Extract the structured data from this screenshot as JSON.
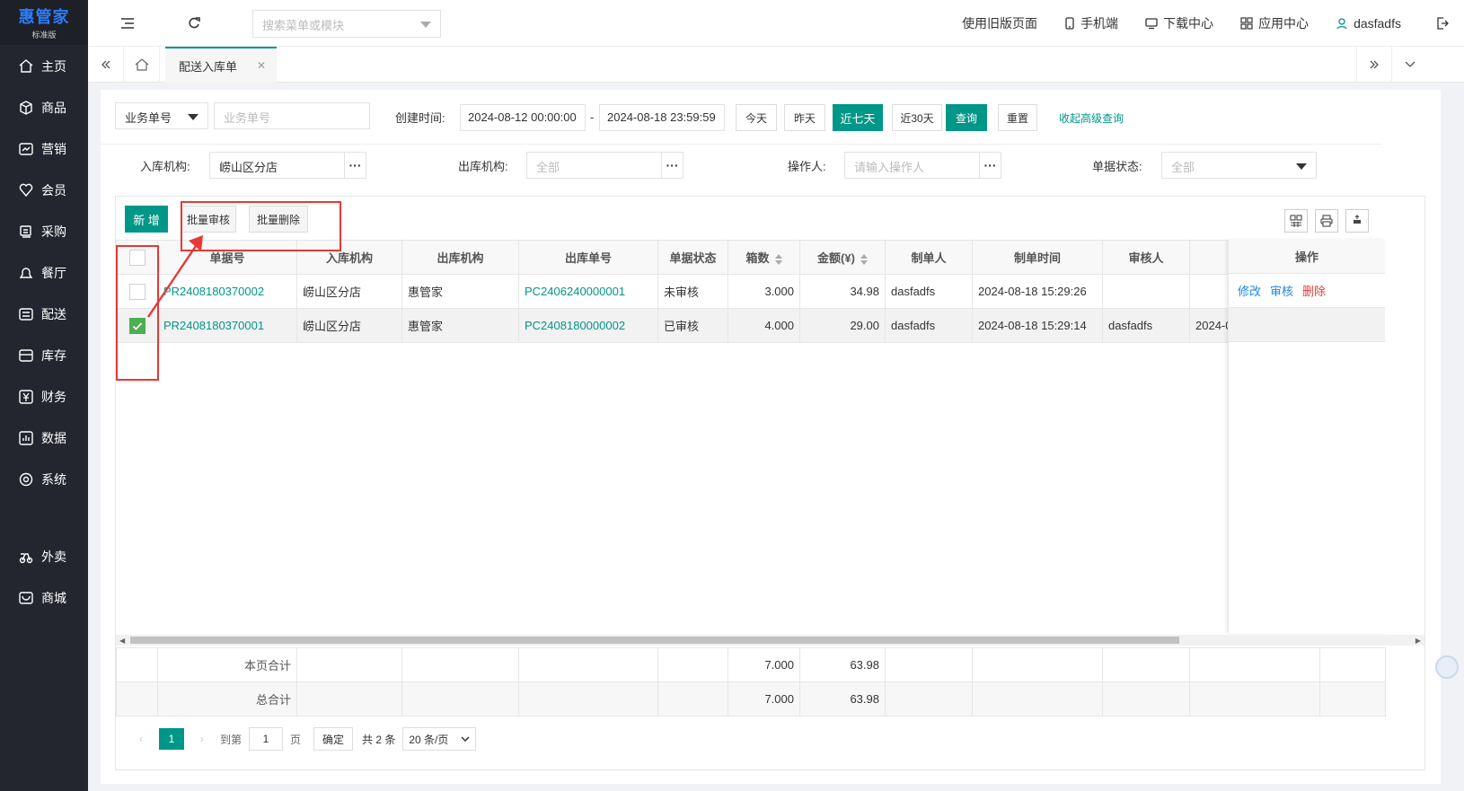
{
  "brand": {
    "name": "惠管家",
    "edition": "标准版"
  },
  "sidebar": {
    "items": [
      {
        "label": "主页",
        "icon": "home-icon"
      },
      {
        "label": "商品",
        "icon": "box-icon"
      },
      {
        "label": "营销",
        "icon": "chart-icon"
      },
      {
        "label": "会员",
        "icon": "heart-icon"
      },
      {
        "label": "采购",
        "icon": "cart-icon"
      },
      {
        "label": "餐厅",
        "icon": "bell-icon"
      },
      {
        "label": "配送",
        "icon": "truck-icon"
      },
      {
        "label": "库存",
        "icon": "storage-icon"
      },
      {
        "label": "财务",
        "icon": "yen-icon"
      },
      {
        "label": "数据",
        "icon": "bar-chart-icon"
      },
      {
        "label": "系统",
        "icon": "settings-icon"
      },
      {
        "label": "外卖",
        "icon": "delivery-icon"
      },
      {
        "label": "商城",
        "icon": "shop-icon"
      }
    ]
  },
  "topbar": {
    "search_placeholder": "搜索菜单或模块",
    "old_version": "使用旧版页面",
    "mobile": "手机端",
    "download": "下载中心",
    "apps": "应用中心",
    "username": "dasfadfs"
  },
  "tabs": {
    "active": "配送入库单"
  },
  "filters": {
    "biz_select": "业务单号",
    "biz_placeholder": "业务单号",
    "created_label": "创建时间:",
    "date_start": "2024-08-12 00:00:00",
    "date_sep": "-",
    "date_end": "2024-08-18 23:59:59",
    "btn_today": "今天",
    "btn_yesterday": "昨天",
    "btn_7days": "近七天",
    "btn_30days": "近30天",
    "btn_query": "查询",
    "btn_reset": "重置",
    "collapse_link": "收起高级查询",
    "in_org_label": "入库机构:",
    "in_org_value": "崂山区分店",
    "out_org_label": "出库机构:",
    "out_org_placeholder": "全部",
    "operator_label": "操作人:",
    "operator_placeholder": "请输入操作人",
    "status_label": "单据状态:",
    "status_placeholder": "全部"
  },
  "toolbar": {
    "add": "新 增",
    "batch_audit": "批量审核",
    "batch_delete": "批量删除"
  },
  "table": {
    "headers": [
      "单据号",
      "入库机构",
      "出库机构",
      "出库单号",
      "单据状态",
      "箱数",
      "金额(¥)",
      "制单人",
      "制单时间",
      "审核人",
      ""
    ],
    "op_header": "操作",
    "rows": [
      {
        "checked": false,
        "doc_no": "PR2408180370002",
        "in_org": "崂山区分店",
        "out_org": "惠管家",
        "out_no": "PC2406240000001",
        "status": "未审核",
        "boxes": "3.000",
        "amount": "34.98",
        "creator": "dasfadfs",
        "created": "2024-08-18 15:29:26",
        "auditor": "",
        "extra": "",
        "ops": [
          "修改",
          "审核",
          "删除"
        ]
      },
      {
        "checked": true,
        "doc_no": "PR2408180370001",
        "in_org": "崂山区分店",
        "out_org": "惠管家",
        "out_no": "PC2408180000002",
        "status": "已审核",
        "boxes": "4.000",
        "amount": "29.00",
        "creator": "dasfadfs",
        "created": "2024-08-18 15:29:14",
        "auditor": "dasfadfs",
        "extra": "2024-0",
        "ops": []
      }
    ]
  },
  "totals": {
    "page_label": "本页合计",
    "page_boxes": "7.000",
    "page_amount": "63.98",
    "all_label": "总合计",
    "all_boxes": "7.000",
    "all_amount": "63.98"
  },
  "pager": {
    "current": "1",
    "goto_label": "到第",
    "goto_value": "1",
    "page_unit": "页",
    "confirm": "确定",
    "total": "共 2 条",
    "page_size": "20 条/页"
  },
  "colors": {
    "accent": "#009688",
    "sidebar": "#23262e",
    "danger": "#e53935",
    "link_blue": "#1e88e5"
  }
}
